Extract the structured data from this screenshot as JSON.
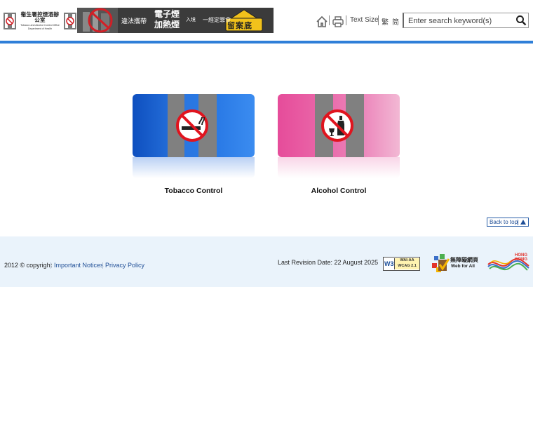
{
  "header": {
    "logo": {
      "chinese": "衞生署控煙酒辦公室",
      "english_line1": "Tobacco and Alcohol Control Office",
      "english_line2": "Department of Health"
    },
    "banner": {
      "text1": "違法攜帶",
      "text2a": "電子煙",
      "text2b": "加熱煙",
      "text3": "入境",
      "text4": "一經定罪會",
      "badge": "留案底"
    },
    "tools": {
      "home_icon": "home-icon",
      "print_icon": "printer-icon",
      "text_size": "Text Size",
      "lang_traditional": "繁",
      "lang_simplified": "简"
    },
    "search": {
      "placeholder": "Enter search keyword(s)",
      "button_icon": "search-icon"
    }
  },
  "main": {
    "cards": [
      {
        "label": "Tobacco Control",
        "icon": "no-smoking-icon"
      },
      {
        "label": "Alcohol Control",
        "icon": "no-alcohol-icon"
      }
    ],
    "back_to_top": "Back to top"
  },
  "footer": {
    "copyright": "2012 © copyright",
    "links": [
      "Important Notices",
      "Privacy Policy"
    ],
    "revision": "Last Revision Date: 22 August 2025",
    "w3c": {
      "mark": "W3C",
      "line1": "WAI-AA",
      "line2": "WCAG 2.1"
    },
    "webforall": {
      "chinese": "無障礙網頁",
      "english": "Web for All"
    },
    "brand_hk": {
      "line1": "HONG",
      "line2": "KONG"
    }
  },
  "colors": {
    "accent_blue": "#2f7fd8",
    "tobacco_card": "#2a76e0",
    "alcohol_card": "#ea6aaa",
    "footer_bg": "#eaf3fb",
    "link": "#1f4e96"
  }
}
